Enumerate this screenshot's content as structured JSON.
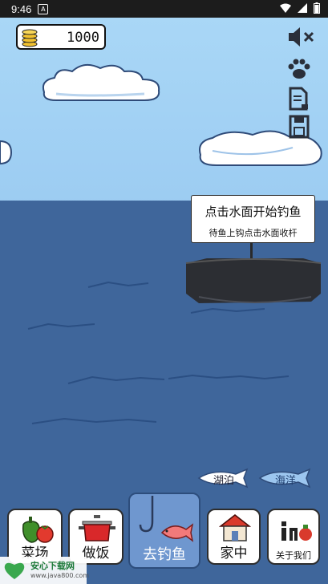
{
  "status_bar": {
    "time": "9:46",
    "notification_glyph": "A"
  },
  "coins": {
    "value": "1000"
  },
  "side_icons": [
    "sound-off-icon",
    "paw-icon",
    "document-icon",
    "save-icon"
  ],
  "tooltip": {
    "title": "点击水面开始钓鱼",
    "subtitle": "待鱼上钩点击水面收杆"
  },
  "locations": [
    {
      "label": "湖泊"
    },
    {
      "label": "海洋"
    }
  ],
  "nav": {
    "market": "菜场",
    "cook": "做饭",
    "fishing": "去钓鱼",
    "home": "家中",
    "about": "关于我们"
  },
  "watermark": {
    "name": "安心下载网",
    "url": "www.java800.com"
  },
  "colors": {
    "sky": "#a9d7f6",
    "sea": "#3f669b",
    "active_nav": "#6f97cf"
  }
}
